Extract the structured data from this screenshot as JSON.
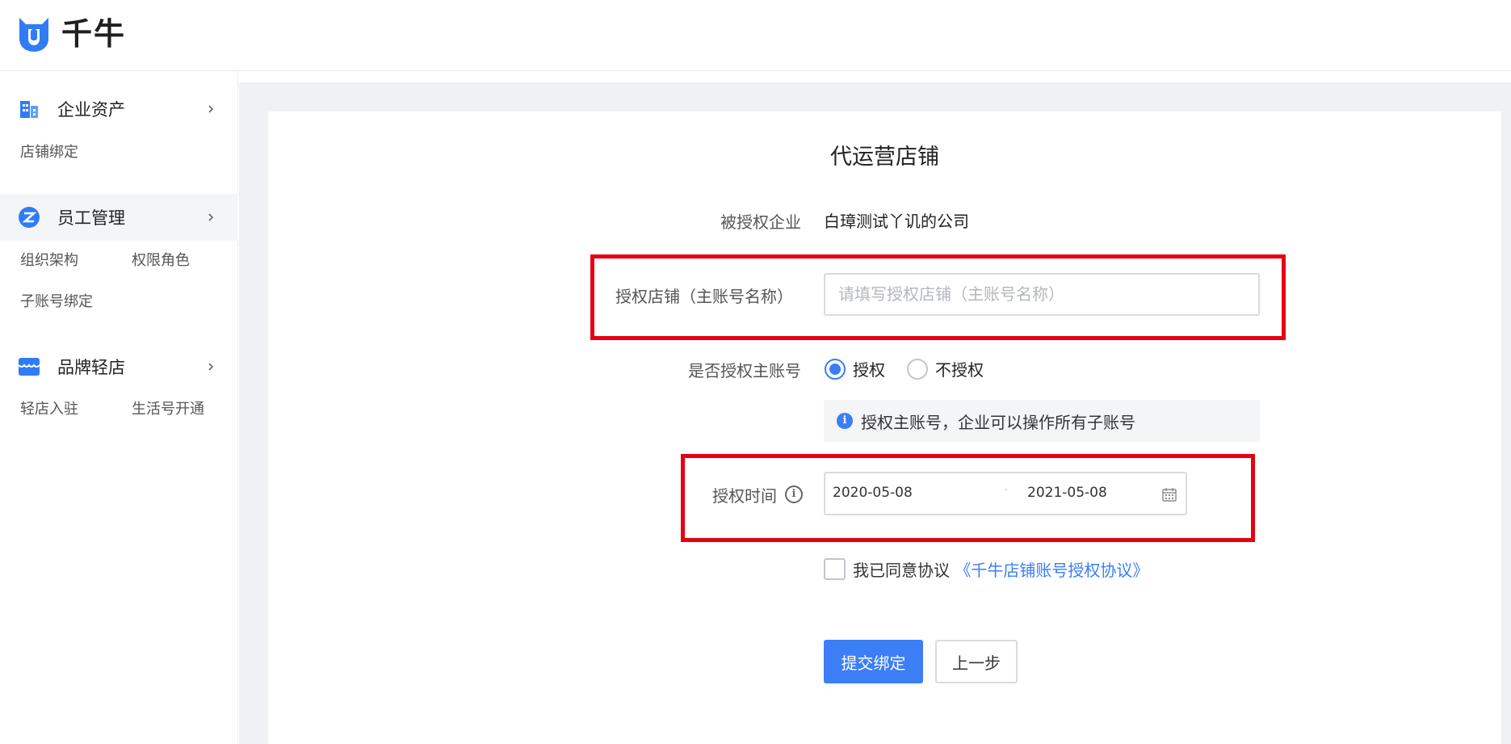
{
  "header": {
    "logo_text": "千牛"
  },
  "sidebar": {
    "groups": [
      {
        "label": "企业资产",
        "icon": "building-icon",
        "items": [
          "店铺绑定"
        ]
      },
      {
        "label": "员工管理",
        "icon": "staff-icon",
        "items": [
          "组织架构",
          "权限角色",
          "子账号绑定"
        ]
      },
      {
        "label": "品牌轻店",
        "icon": "store-icon",
        "items": [
          "轻店入驻",
          "生活号开通"
        ]
      }
    ]
  },
  "form": {
    "title": "代运营店铺",
    "company_label": "被授权企业",
    "company_value": "白璋测试丫讥的公司",
    "shop_label": "授权店铺（主账号名称）",
    "shop_placeholder": "请填写授权店铺（主账号名称）",
    "auth_main_label": "是否授权主账号",
    "radio_yes": "授权",
    "radio_no": "不授权",
    "notice": "授权主账号，企业可以操作所有子账号",
    "time_label": "授权时间",
    "start_date": "2020-05-08",
    "end_date": "2021-05-08",
    "date_separator": "-",
    "agree_prefix": "我已同意协议",
    "agree_link": "《千牛店铺账号授权协议》",
    "submit": "提交绑定",
    "prev": "上一步"
  },
  "colors": {
    "accent": "#3b7ef6",
    "highlight": "#e60012",
    "background": "#f0f1f4"
  }
}
